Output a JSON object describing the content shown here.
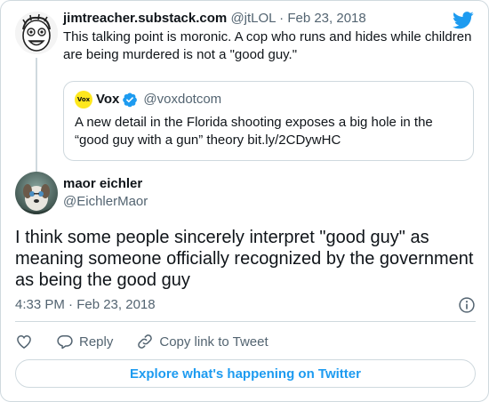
{
  "brand": {
    "twitter_blue": "#1d9bf0",
    "text_dark": "#0f1419",
    "text_muted": "#536471",
    "border": "#cfd9de",
    "vox_yellow": "#fee71d"
  },
  "parent_tweet": {
    "author_name": "jimtreacher.substack.com",
    "author_handle": "@jtLOL",
    "separator": "·",
    "date": "Feb 23, 2018",
    "text": "This talking point is moronic. A cop who runs and hides while children are being murdered is not a \"good guy.\""
  },
  "quoted_tweet": {
    "avatar_text": "Vox",
    "author_name": "Vox",
    "author_handle": "@voxdotcom",
    "text": "A new detail in the Florida shooting exposes a big hole in the “good guy with a gun” theory bit.ly/2CDywHC"
  },
  "main_tweet": {
    "author_name": "maor eichler",
    "author_handle": "@EichlerMaor",
    "text": "I think some people sincerely interpret \"good guy\" as meaning someone officially recognized by the government as being the good guy",
    "timestamp": "4:33 PM · Feb 23, 2018"
  },
  "actions": {
    "like_icon": "heart-icon",
    "reply_label": "Reply",
    "copy_label": "Copy link to Tweet"
  },
  "explore_label": "Explore what's happening on Twitter"
}
